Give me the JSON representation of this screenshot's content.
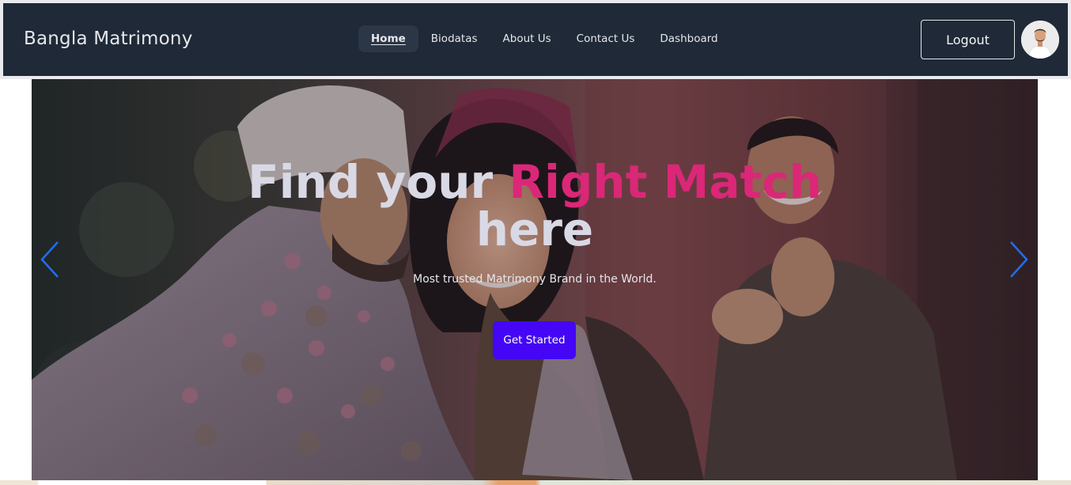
{
  "navbar": {
    "brand": "Bangla Matrimony",
    "links": [
      {
        "label": "Home",
        "active": true
      },
      {
        "label": "Biodatas",
        "active": false
      },
      {
        "label": "About Us",
        "active": false
      },
      {
        "label": "Contact Us",
        "active": false
      },
      {
        "label": "Dashboard",
        "active": false
      }
    ],
    "logout_label": "Logout",
    "avatar_icon": "user-avatar-photo"
  },
  "hero": {
    "title_part1": "Find your ",
    "title_accent": "Right Match",
    "title_part2": "here",
    "subtitle": "Most trusted Matrimony Brand in the World.",
    "cta_label": "Get Started",
    "prev_icon": "chevron-left-icon",
    "next_icon": "chevron-right-icon"
  },
  "colors": {
    "navbar_bg": "#1f2937",
    "accent_pink": "#db2777",
    "cta_bg": "#4406f5",
    "arrow_blue": "#1d6ff2"
  }
}
